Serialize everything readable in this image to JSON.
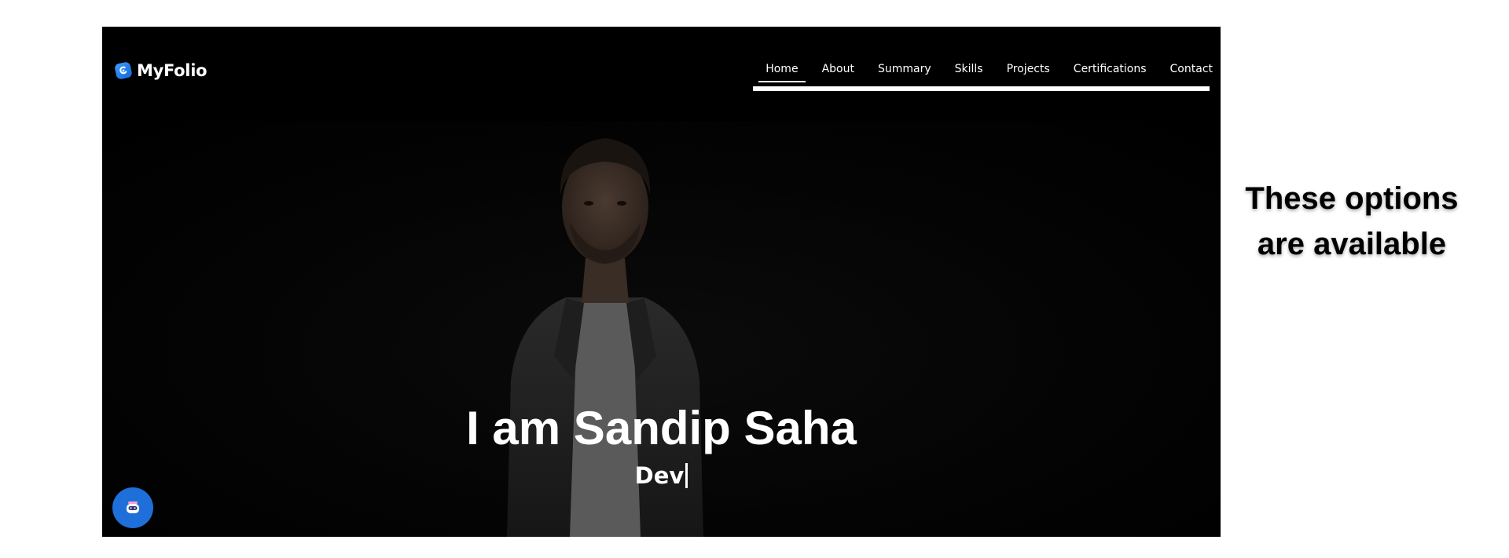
{
  "header": {
    "logo_text": "MyFolio",
    "nav": [
      {
        "label": "Home",
        "active": true
      },
      {
        "label": "About",
        "active": false
      },
      {
        "label": "Summary",
        "active": false
      },
      {
        "label": "Skills",
        "active": false
      },
      {
        "label": "Projects",
        "active": false
      },
      {
        "label": "Certifications",
        "active": false
      },
      {
        "label": "Contact",
        "active": false
      }
    ]
  },
  "hero": {
    "title": "I am Sandip Saha",
    "subtitle": "Dev"
  },
  "chat_button": {
    "icon": "robot-icon"
  },
  "caption": {
    "line1": "These options",
    "line2": "are available"
  },
  "colors": {
    "background": "#000000",
    "text": "#ffffff",
    "accent": "#1e6fd9"
  }
}
